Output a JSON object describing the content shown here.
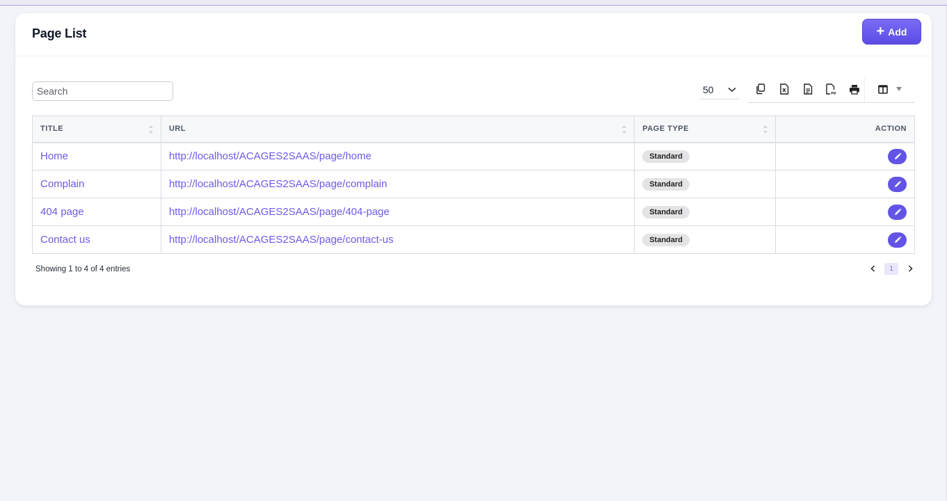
{
  "header": {
    "title": "Page List",
    "add_label": "Add"
  },
  "controls": {
    "search_placeholder": "Search",
    "page_length": "50",
    "toolbar_icons": [
      "copy-icon",
      "excel-icon",
      "csv-icon",
      "pdf-icon",
      "print-icon",
      "column-visibility-icon"
    ]
  },
  "table": {
    "columns": [
      "TITLE",
      "URL",
      "PAGE TYPE",
      "ACTION"
    ],
    "rows": [
      {
        "title": "Home",
        "url": "http://localhost/ACAGES2SAAS/page/home",
        "type": "Standard"
      },
      {
        "title": "Complain",
        "url": "http://localhost/ACAGES2SAAS/page/complain",
        "type": "Standard"
      },
      {
        "title": "404 page",
        "url": "http://localhost/ACAGES2SAAS/page/404-page",
        "type": "Standard"
      },
      {
        "title": "Contact us",
        "url": "http://localhost/ACAGES2SAAS/page/contact-us",
        "type": "Standard"
      }
    ]
  },
  "footer": {
    "info": "Showing 1 to 4 of 4 entries",
    "current_page": "1"
  },
  "colors": {
    "accent": "#6354e6",
    "link": "#6a5be8",
    "background": "#f3f4f9"
  }
}
